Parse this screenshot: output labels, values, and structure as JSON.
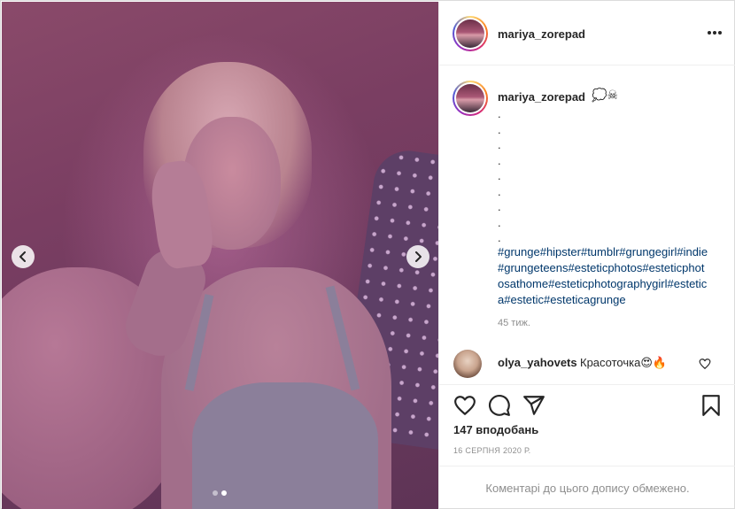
{
  "post": {
    "username": "mariya_zorepad",
    "carousel": {
      "current": 2,
      "total": 2
    }
  },
  "caption": {
    "username": "mariya_zorepad",
    "emojis": "💭☠",
    "dots": ".\n.\n.\n.\n.\n.\n.\n.\n.",
    "hashtags": "#grunge#hipster#tumblr#grungegirl#indie#grungeteens#esteticphotos#esteticphotosathome#esteticphotographygirl#estetica#estetic#esteticagrunge",
    "time": "45 тиж."
  },
  "comment": {
    "username": "olya_yahovets",
    "text": "Красоточка😍🔥"
  },
  "stats": {
    "likes": "147 вподобань",
    "date": "16 СЕРПНЯ 2020 Р."
  },
  "footer": {
    "notice": "Коментарі до цього допису обмежено."
  },
  "icons": {
    "more": "more-icon",
    "like": "heart-icon",
    "comment": "comment-icon",
    "share": "share-icon",
    "save": "bookmark-icon",
    "prev": "chevron-left-icon",
    "next": "chevron-right-icon"
  },
  "colors": {
    "link": "#00376b",
    "muted": "#8e8e8e",
    "text": "#262626"
  }
}
